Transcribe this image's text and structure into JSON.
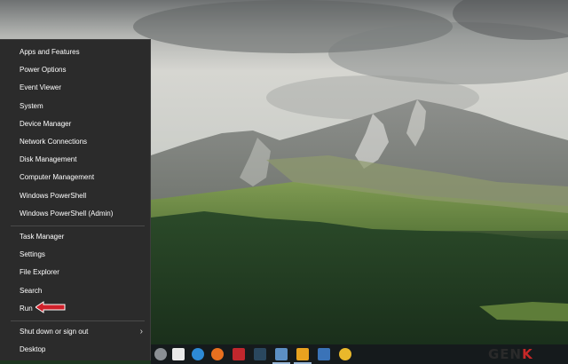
{
  "menu": {
    "groups": [
      [
        "Apps and Features",
        "Power Options",
        "Event Viewer",
        "System",
        "Device Manager",
        "Network Connections",
        "Disk Management",
        "Computer Management",
        "Windows PowerShell",
        "Windows PowerShell (Admin)"
      ],
      [
        "Task Manager",
        "Settings",
        "File Explorer",
        "Search",
        "Run"
      ],
      [
        "Shut down or sign out",
        "Desktop"
      ]
    ],
    "highlighted": "Run",
    "submenu_item": "Shut down or sign out"
  },
  "taskbar": {
    "icons": [
      "apple-icon",
      "blender-icon",
      "edge-icon",
      "firefox-icon",
      "filezilla-icon",
      "steam-icon",
      "notepad-icon",
      "media-player-icon",
      "photos-icon",
      "chrome-icon"
    ]
  },
  "watermark": {
    "prefix": "GEN",
    "suffix": "K"
  },
  "colors": {
    "menu_bg": "#2b2b2b",
    "menu_text": "#ffffff",
    "annotation_arrow": "#d0202a",
    "taskbar_bg": "#151a1c"
  }
}
